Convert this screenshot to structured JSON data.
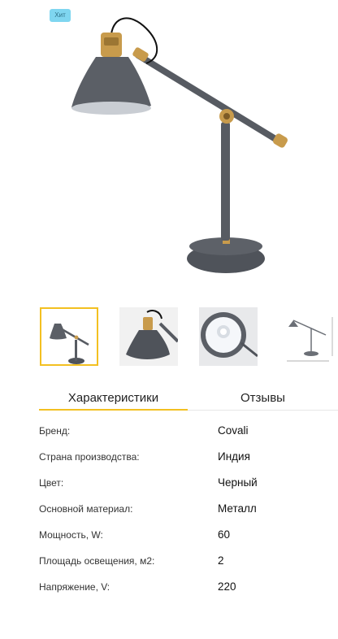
{
  "product": {
    "badge": "Хит",
    "colors": {
      "badge_bg": "#7fd6f0",
      "accent": "#f3c021",
      "lamp": "#5b5f66",
      "brass": "#c89b4c"
    }
  },
  "gallery": {
    "thumbnails": [
      {
        "name": "lamp-full-view",
        "active": true
      },
      {
        "name": "lamp-shade-closeup",
        "active": false
      },
      {
        "name": "lamp-shade-inside",
        "active": false
      },
      {
        "name": "lamp-dimensions-drawing",
        "active": false
      }
    ]
  },
  "tabs": [
    {
      "label": "Характеристики",
      "active": true
    },
    {
      "label": "Отзывы",
      "active": false
    }
  ],
  "specs": [
    {
      "label": "Бренд:",
      "value": "Covali"
    },
    {
      "label": "Страна производства:",
      "value": "Индия"
    },
    {
      "label": "Цвет:",
      "value": "Черный"
    },
    {
      "label": "Основной материал:",
      "value": "Металл"
    },
    {
      "label": "Мощность, W:",
      "value": "60"
    },
    {
      "label": "Площадь освещения, м2:",
      "value": "2"
    },
    {
      "label": "Напряжение, V:",
      "value": "220"
    }
  ]
}
